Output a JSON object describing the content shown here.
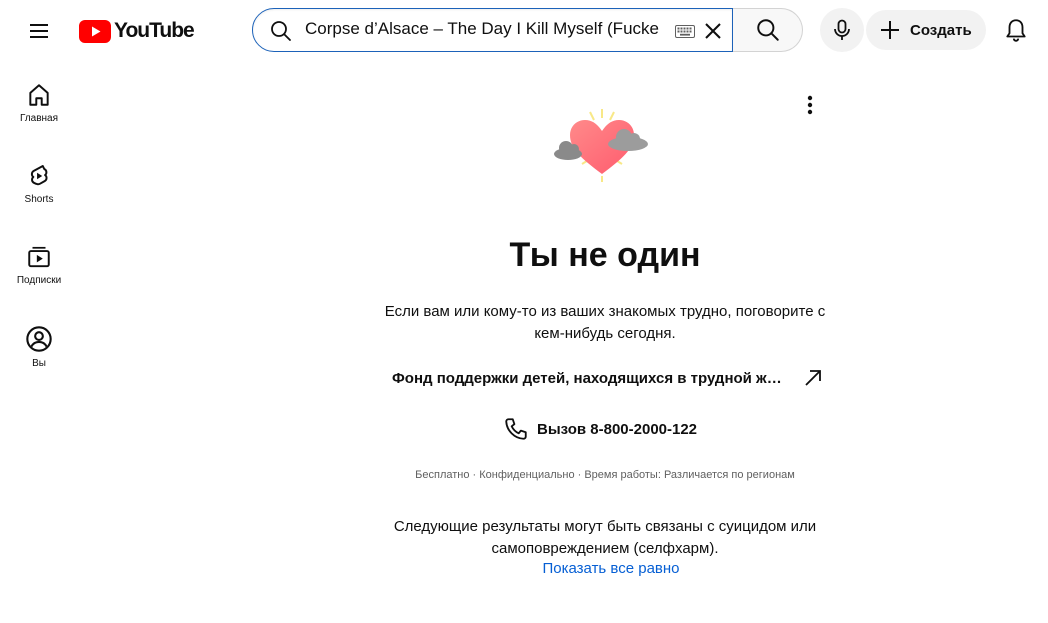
{
  "header": {
    "logo_text": "YouTube",
    "search_value": "Corpse d’Alsace – The Day I Kill Myself (Fucke",
    "create_label": "Создать",
    "brand_color": "#ff0000"
  },
  "sidebar": {
    "items": [
      {
        "label": "Главная",
        "icon": "home-icon"
      },
      {
        "label": "Shorts",
        "icon": "shorts-icon"
      },
      {
        "label": "Подписки",
        "icon": "subscriptions-icon"
      },
      {
        "label": "Вы",
        "icon": "you-icon"
      }
    ]
  },
  "crisis": {
    "title": "Ты не один",
    "description": "Если вам или кому-то из ваших знакомых трудно, поговорите с кем-нибудь сегодня.",
    "org_name": "Фонд поддержки детей, находящихся в трудной жизненной ситуации",
    "call_label": "Вызов 8-800-2000-122",
    "meta": "Бесплатно · Конфиденциально · Время работы: Различается по регионам",
    "warning": "Следующие результаты могут быть связаны с суицидом или самоповреждением (селфхарм).",
    "show_anyway": "Показать все равно",
    "link_color": "#065fd4"
  }
}
